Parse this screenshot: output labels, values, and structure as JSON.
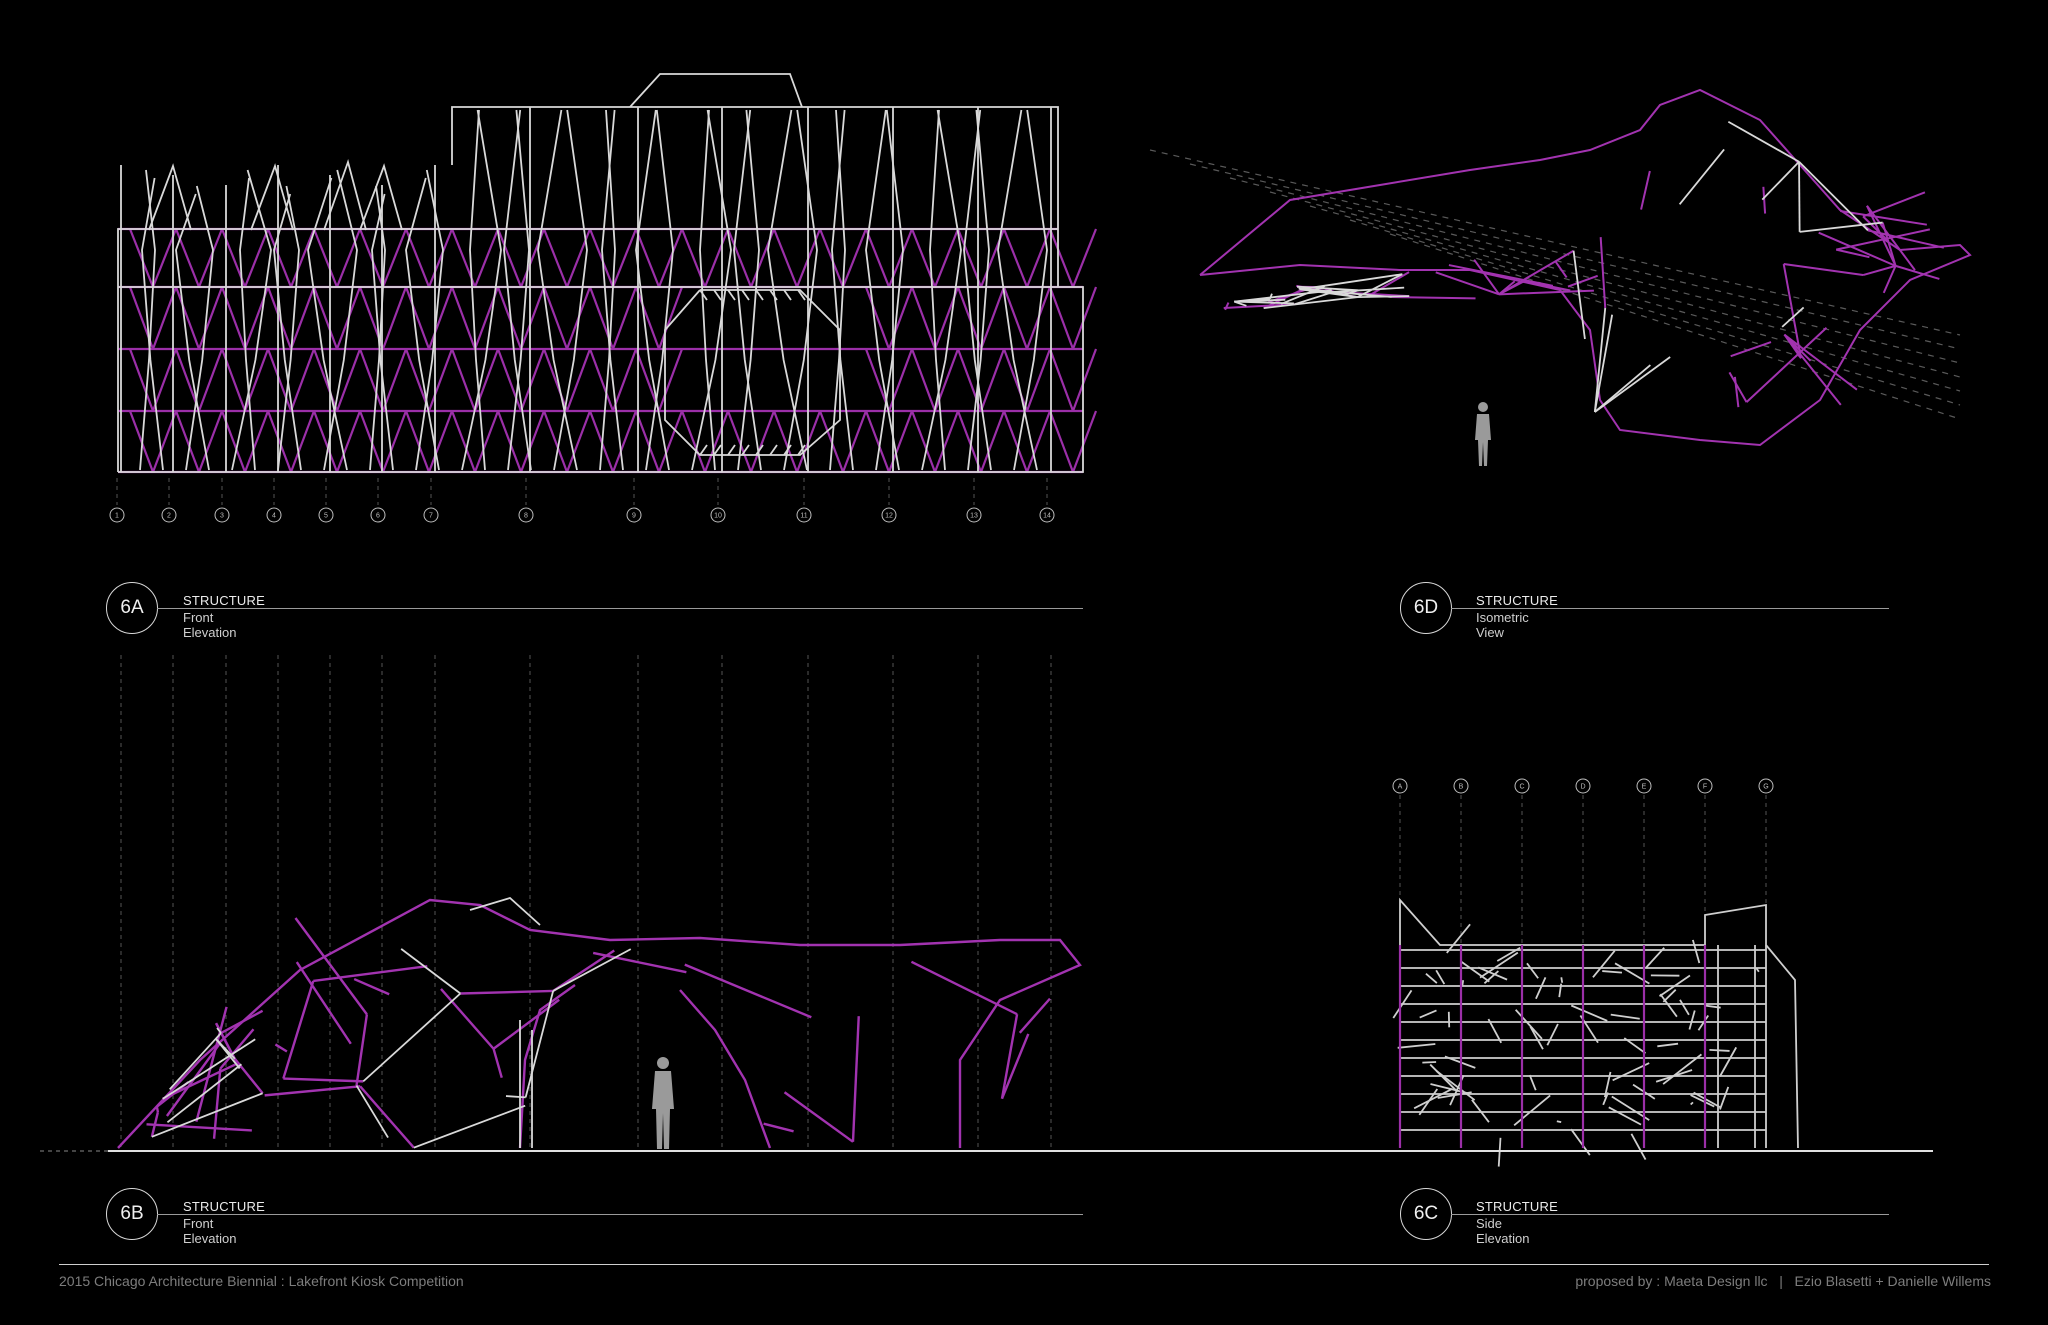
{
  "colors": {
    "background": "#000000",
    "primary_structure": "#9b2fa8",
    "secondary_structure": "#d9d9d9",
    "text": "#e6e6e6",
    "footer_text": "#7d7d7d"
  },
  "panels": {
    "p6a": {
      "badge": "6A",
      "heading": "STRUCTURE",
      "subheading": "Front Elevation"
    },
    "p6b": {
      "badge": "6B",
      "heading": "STRUCTURE",
      "subheading": "Front Elevation"
    },
    "p6c": {
      "badge": "6C",
      "heading": "STRUCTURE",
      "subheading": "Side Elevation"
    },
    "p6d": {
      "badge": "6D",
      "heading": "STRUCTURE",
      "subheading": "Isometric View"
    }
  },
  "grid_numbers": [
    "1",
    "2",
    "3",
    "4",
    "5",
    "6",
    "7",
    "8",
    "9",
    "10",
    "11",
    "12",
    "13",
    "14"
  ],
  "grid_letters": [
    "A",
    "B",
    "C",
    "D",
    "E",
    "F",
    "G"
  ],
  "footer": {
    "left": "2015 Chicago Architecture Biennial : Lakefront Kiosk Competition",
    "right": "proposed by : Maeta Design llc   |   Ezio Blasetti + Danielle Willems"
  }
}
